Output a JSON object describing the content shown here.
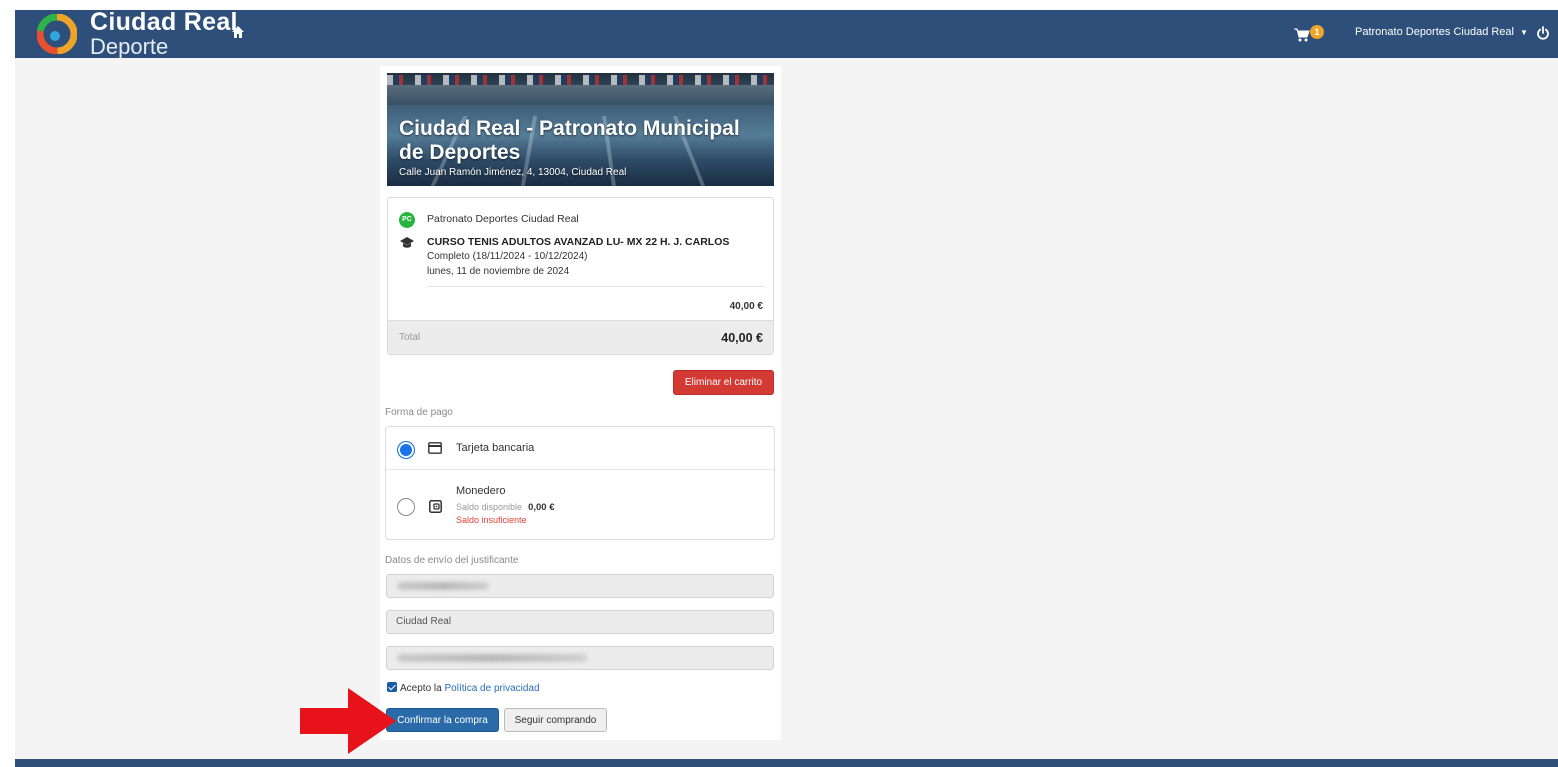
{
  "header": {
    "brand_line1": "Ciudad Real",
    "brand_line2": "Deporte",
    "cart_count": "1",
    "user_name": "Patronato Deportes Ciudad Real",
    "colors": {
      "bar": "#2d4f79",
      "badge": "#f0a427"
    }
  },
  "venue": {
    "title": "Ciudad Real - Patronato Municipal de Deportes",
    "address": "Calle Juan Ramón Jiménez, 4, 13004, Ciudad Real"
  },
  "order": {
    "entity_badge": "PC",
    "entity": "Patronato Deportes Ciudad Real",
    "course": "CURSO TENIS ADULTOS AVANZAD LU- MX 22 H. J. CARLOS",
    "period": "Completo (18/11/2024 - 10/12/2024)",
    "date": "lunes, 11 de noviembre de 2024",
    "line_price": "40,00 €",
    "total_label": "Total",
    "total_value": "40,00 €"
  },
  "actions": {
    "delete_cart": "Eliminar el carrito",
    "confirm": "Confirmar la compra",
    "continue": "Seguir comprando"
  },
  "payment": {
    "section_label": "Forma de pago",
    "options": [
      {
        "label": "Tarjeta bancaria",
        "selected": true
      },
      {
        "label": "Monedero",
        "balance_label": "Saldo disponible",
        "balance": "0,00 €",
        "warning": "Saldo insuficiente",
        "selected": false
      }
    ]
  },
  "shipping": {
    "section_label": "Datos de envío del justificante",
    "fields": [
      "",
      "Ciudad Real",
      ""
    ]
  },
  "privacy": {
    "prefix": "Acepto la",
    "link": "Política de privacidad",
    "checked": true
  }
}
